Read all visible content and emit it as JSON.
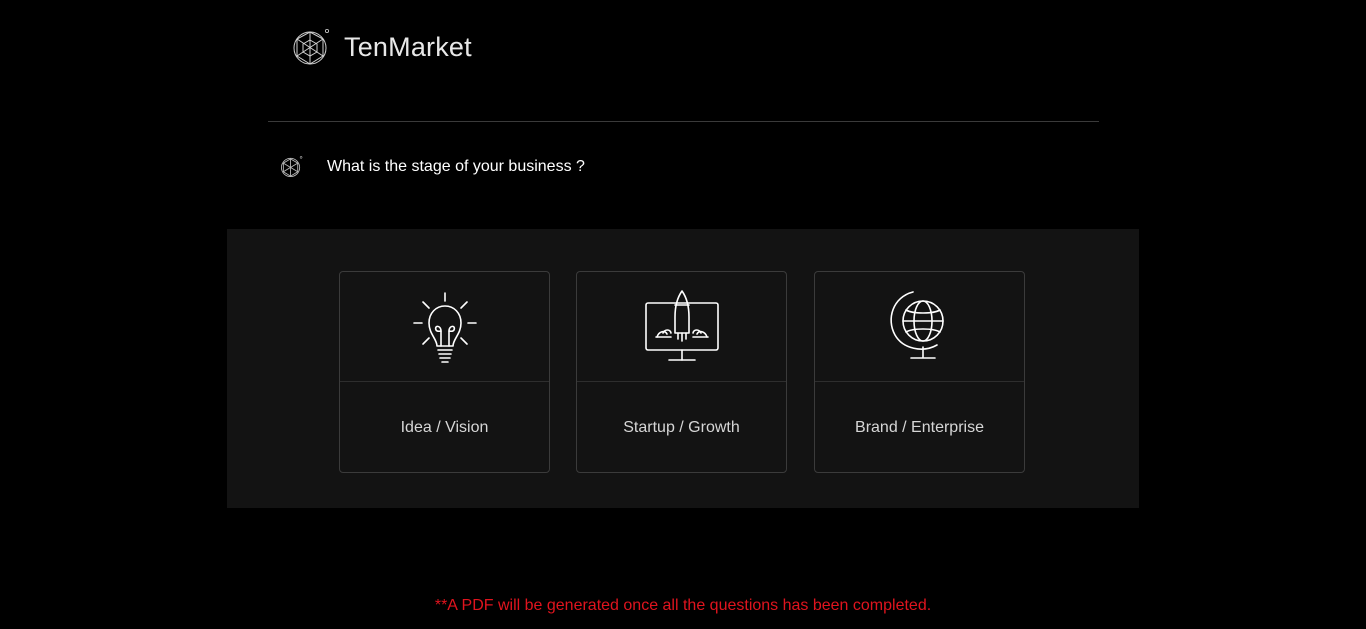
{
  "header": {
    "brand_name": "TenMarket",
    "logo_icon": "geodesic-sphere-icon"
  },
  "question": {
    "text": "What is the stage of your business ?",
    "icon": "geodesic-sphere-icon"
  },
  "options": [
    {
      "label": "Idea / Vision",
      "icon": "lightbulb-icon"
    },
    {
      "label": "Startup / Growth",
      "icon": "rocket-monitor-icon"
    },
    {
      "label": "Brand / Enterprise",
      "icon": "globe-icon"
    }
  ],
  "footer": {
    "note": "**A PDF will be generated once all the questions has been completed."
  },
  "colors": {
    "background": "#000000",
    "panel": "#131313",
    "note_text": "#e0141e",
    "card_border": "#3b3b3b"
  }
}
